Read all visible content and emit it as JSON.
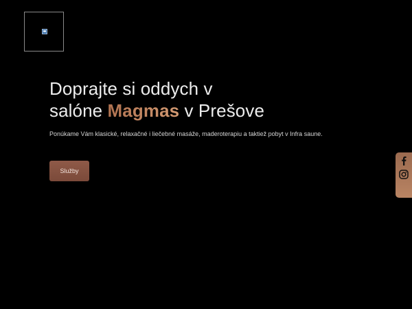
{
  "logo": {
    "icon": "broken-image-icon"
  },
  "hero": {
    "title_line1": "Doprajte si oddych v",
    "title_line2_prefix": "salóne ",
    "title_brand": "Magmas",
    "title_line2_suffix": " v Prešove",
    "subtitle": "Ponúkame Vám klasické, relaxačné i liečebné masáže, maderoterapiu a taktiež pobyt v Infra saune.",
    "cta_label": "Služby"
  },
  "social": {
    "items": [
      {
        "icon": "facebook-icon"
      },
      {
        "icon": "instagram-icon"
      }
    ]
  },
  "colors": {
    "background": "#000000",
    "accent": "#c58863",
    "button": "#8a5747",
    "social_bar": "#a87456"
  }
}
